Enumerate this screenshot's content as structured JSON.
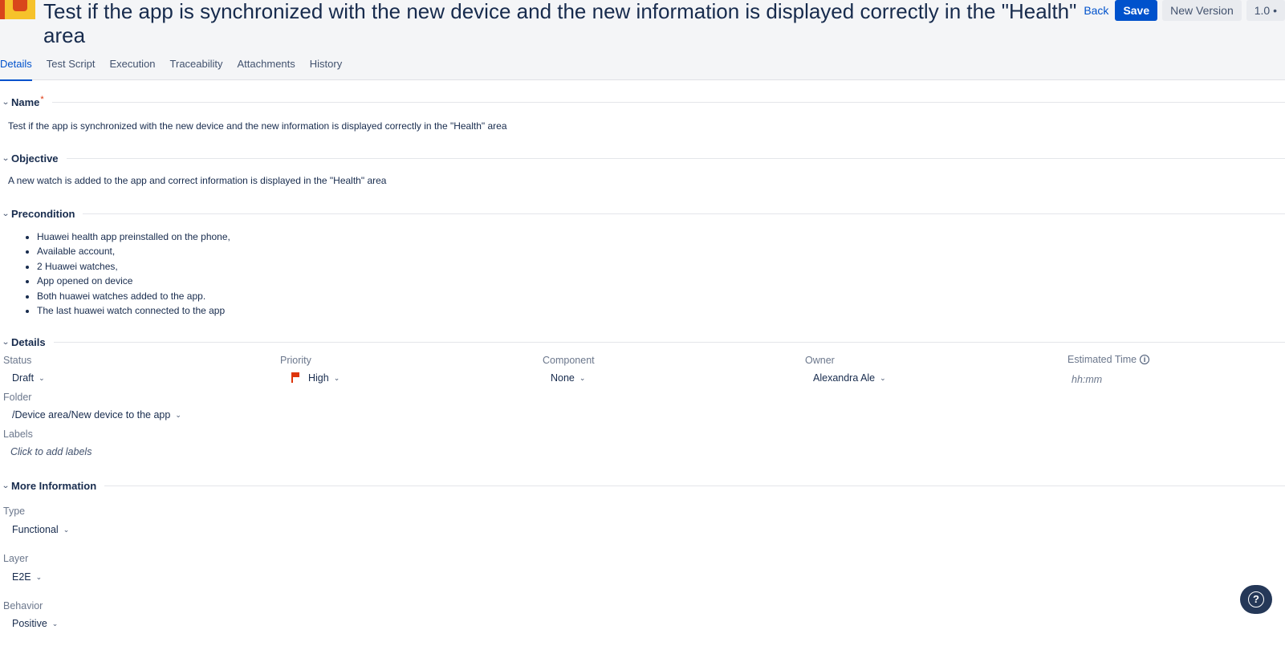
{
  "header": {
    "title": "Test if the app is synchronized with the new device and the new information is displayed correctly in the \"Health\" area",
    "back_label": "Back",
    "save_label": "Save",
    "new_version_label": "New Version",
    "version_label": "1.0 •"
  },
  "tabs": [
    {
      "label": "Details"
    },
    {
      "label": "Test Script"
    },
    {
      "label": "Execution"
    },
    {
      "label": "Traceability"
    },
    {
      "label": "Attachments"
    },
    {
      "label": "History"
    }
  ],
  "sections": {
    "name": {
      "title": "Name",
      "required_mark": "*",
      "value": "Test if the app is synchronized with the new device and the new information is displayed correctly in the \"Health\" area"
    },
    "objective": {
      "title": "Objective",
      "value": "A new watch is added to the app and correct information is displayed in the \"Health\" area"
    },
    "precondition": {
      "title": "Precondition",
      "items": [
        "Huawei health app preinstalled on the phone,",
        "Available account,",
        "2 Huawei watches,",
        "App opened on device",
        "Both huawei watches added to the app.",
        "The last huawei watch connected to the app"
      ]
    },
    "details": {
      "title": "Details",
      "status_label": "Status",
      "status_value": "Draft",
      "priority_label": "Priority",
      "priority_value": "High",
      "priority_color": "#de350b",
      "component_label": "Component",
      "component_value": "None",
      "owner_label": "Owner",
      "owner_value": "Alexandra Ale",
      "estimated_label": "Estimated Time",
      "estimated_placeholder": "hh:mm",
      "folder_label": "Folder",
      "folder_value": "/Device area/New device to the app",
      "labels_label": "Labels",
      "labels_placeholder": "Click to add labels"
    },
    "more_info": {
      "title": "More Information",
      "type_label": "Type",
      "type_value": "Functional",
      "layer_label": "Layer",
      "layer_value": "E2E",
      "behavior_label": "Behavior",
      "behavior_value": "Positive"
    }
  },
  "help": {
    "glyph": "?"
  },
  "colors": {
    "accent": "#0052cc",
    "header_bg": "#f4f5f7",
    "text": "#172b4d"
  }
}
